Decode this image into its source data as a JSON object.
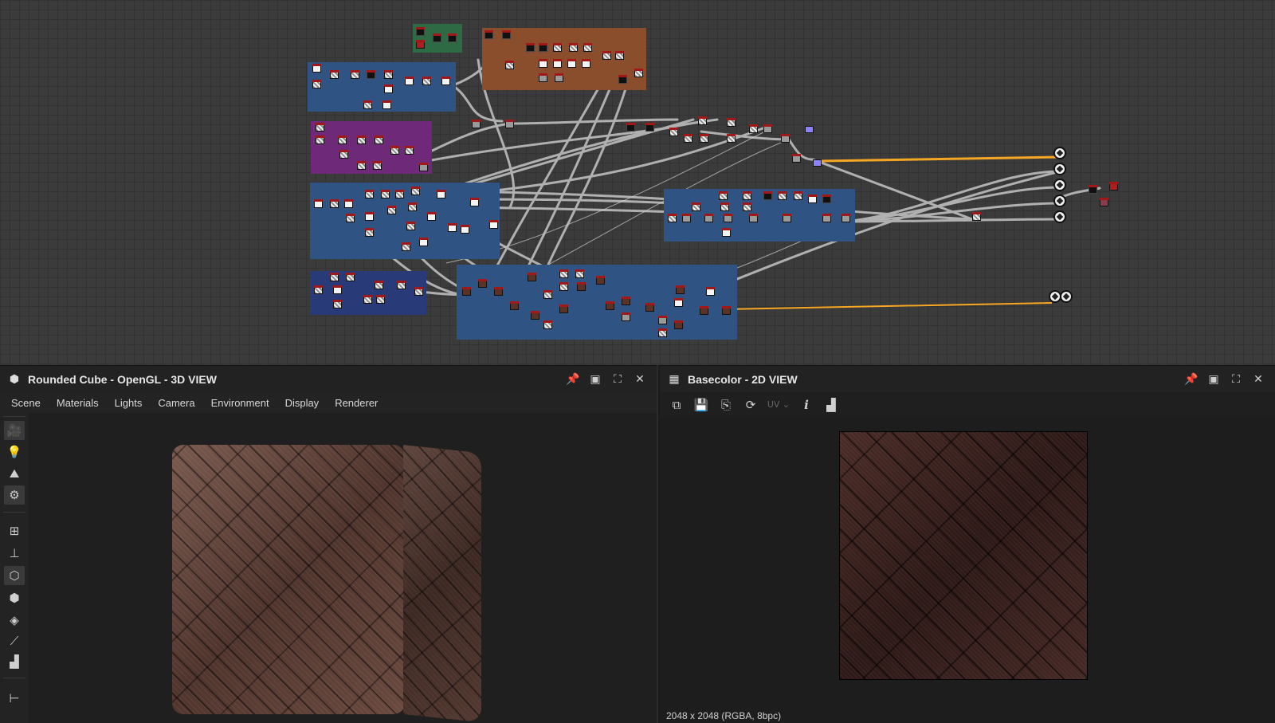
{
  "graph": {
    "frame_titles": [
      "",
      "",
      "",
      "",
      "",
      "",
      "",
      ""
    ]
  },
  "panel3d": {
    "title": "Rounded Cube - OpenGL - 3D VIEW",
    "menu": [
      "Scene",
      "Materials",
      "Lights",
      "Camera",
      "Environment",
      "Display",
      "Renderer"
    ],
    "icons": [
      "camera-icon",
      "light-icon",
      "environment-icon",
      "render-settings-icon",
      "grid-icon",
      "axis-icon",
      "cube-icon",
      "wireframe-icon",
      "layers-icon",
      "transform-icon",
      "histogram-icon",
      "hierarchy-icon"
    ]
  },
  "panel2d": {
    "title": "Basecolor - 2D VIEW",
    "uv_label": "UV",
    "info_label": "i",
    "status": "2048 x 2048 (RGBA, 8bpc)"
  },
  "titlebar_icons": [
    "pin-icon",
    "restore-icon",
    "maximize-icon",
    "close-icon"
  ]
}
